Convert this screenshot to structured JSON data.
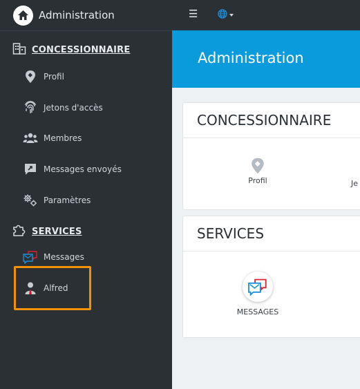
{
  "brand": {
    "title": "Administration",
    "icon": "home-icon"
  },
  "topbar": {
    "menu_icon": "hamburger-icon",
    "language_icon": "globe-icon"
  },
  "sidebar": {
    "dealer_section": "CONCESSIONNAIRE",
    "items": [
      {
        "label": "Profil",
        "icon": "location-pin-icon"
      },
      {
        "label": "Jetons d'accès",
        "icon": "fingerprint-icon"
      },
      {
        "label": "Membres",
        "icon": "users-icon"
      },
      {
        "label": "Messages envoyés",
        "icon": "send-message-icon"
      },
      {
        "label": "Paramètres",
        "icon": "gears-icon"
      }
    ],
    "services_section": "SERVICES",
    "service_items": [
      {
        "label": "Messages",
        "icon": "messages-icon"
      },
      {
        "label": "Alfred",
        "icon": "person-icon"
      }
    ]
  },
  "banner": {
    "title": "Administration"
  },
  "cards": {
    "dealer": {
      "title": "CONCESSIONNAIRE",
      "tiles": [
        "Profil",
        "Je"
      ]
    },
    "services": {
      "title": "SERVICES",
      "tiles": [
        "MESSAGES"
      ]
    }
  },
  "colors": {
    "sidebar": "#2b3035",
    "accent": "#0a9bdc",
    "highlight": "#f39200"
  }
}
